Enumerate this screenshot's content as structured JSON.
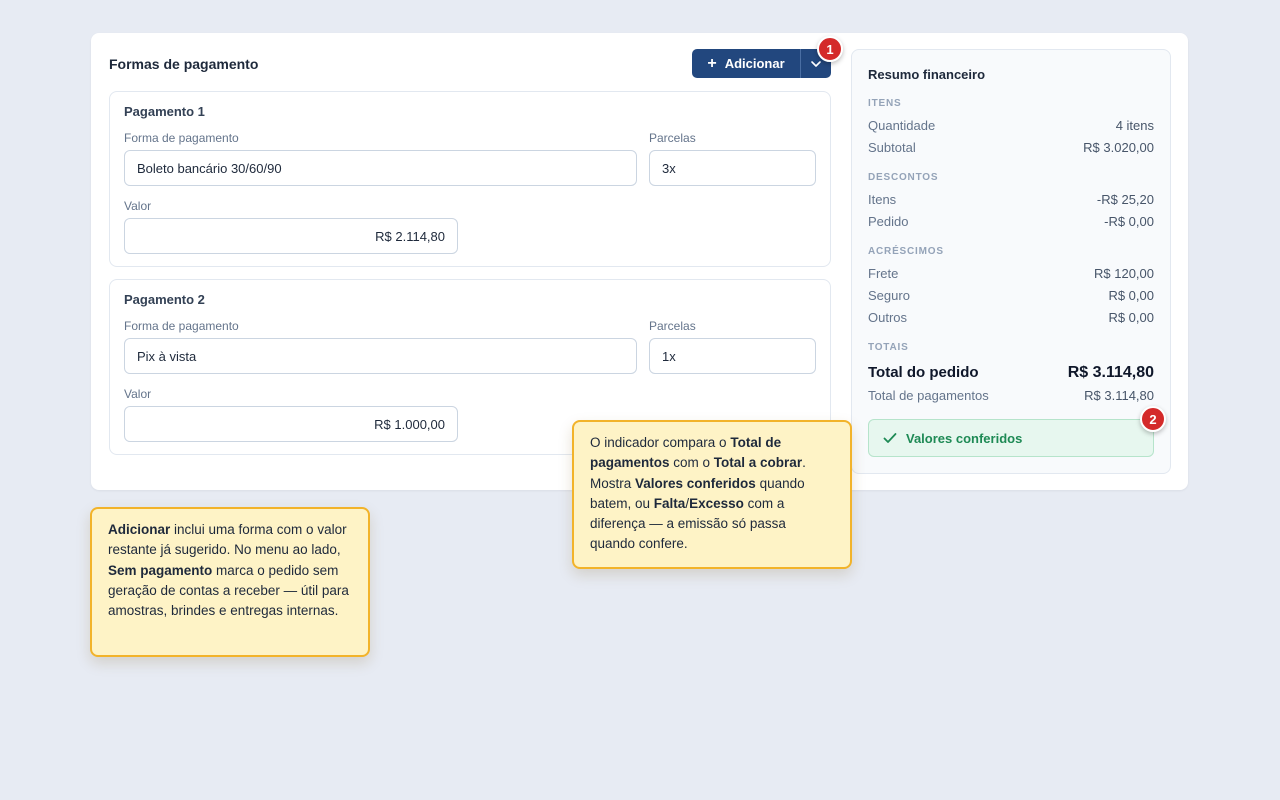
{
  "payments_section": {
    "title": "Formas de pagamento",
    "add_label": "Adicionar",
    "add_icon": "plus-icon",
    "menu_icon": "chevron-down-icon",
    "payments": [
      {
        "title": "Pagamento 1",
        "method_label": "Forma de pagamento",
        "method_value": "Boleto bancário 30/60/90",
        "installments_label": "Parcelas",
        "installments_value": "3x",
        "amount_label": "Valor",
        "amount_value": "R$ 2.114,80"
      },
      {
        "title": "Pagamento 2",
        "method_label": "Forma de pagamento",
        "method_value": "Pix à vista",
        "installments_label": "Parcelas",
        "installments_value": "1x",
        "amount_label": "Valor",
        "amount_value": "R$ 1.000,00"
      }
    ]
  },
  "summary": {
    "title": "Resumo financeiro",
    "groups": {
      "items": "ITENS",
      "discounts": "DESCONTOS",
      "additions": "ACRÉSCIMOS",
      "totals": "TOTAIS"
    },
    "rows": {
      "quantity": {
        "label": "Quantidade",
        "value": "4 itens"
      },
      "subtotal": {
        "label": "Subtotal",
        "value": "R$ 3.020,00"
      },
      "disc_items": {
        "label": "Itens",
        "value": "-R$ 25,20"
      },
      "disc_order": {
        "label": "Pedido",
        "value": "-R$ 0,00"
      },
      "freight": {
        "label": "Frete",
        "value": "R$ 120,00"
      },
      "insurance": {
        "label": "Seguro",
        "value": "R$ 0,00"
      },
      "others": {
        "label": "Outros",
        "value": "R$ 0,00"
      },
      "order_total": {
        "label": "Total do pedido",
        "value": "R$ 3.114,80"
      },
      "payments_total": {
        "label": "Total de pagamentos",
        "value": "R$ 3.114,80"
      }
    },
    "status_label": "Valores conferidos",
    "status_icon": "check-icon",
    "status_color": "#1e8a55"
  },
  "callouts": {
    "badge_1": "1",
    "badge_2": "2",
    "note_add": {
      "p1": "Adicionar",
      "p2": " inclui uma forma com o valor restante já sugerido. No menu ao lado, ",
      "p3": "Sem pagamento",
      "p4": " marca o pedido sem geração de contas a receber — útil para amostras, brindes e entregas internas."
    },
    "note_status": {
      "p1": "O indicador compara o ",
      "p2": "Total de pagamentos",
      "p3": " com o ",
      "p4": "Total a cobrar",
      "p5": ". Mostra ",
      "p6": "Valores conferidos",
      "p7": " quando batem, ou ",
      "p8": "Falta",
      "p9": "/",
      "p10": "Excesso",
      "p11": " com a diferença — a emissão só passa quando confere."
    }
  },
  "colors": {
    "primary": "#22477e",
    "badge": "#d42a2a",
    "note_bg": "#fef3c6",
    "note_border": "#f2b32a",
    "success_bg": "#e7f7ef"
  }
}
